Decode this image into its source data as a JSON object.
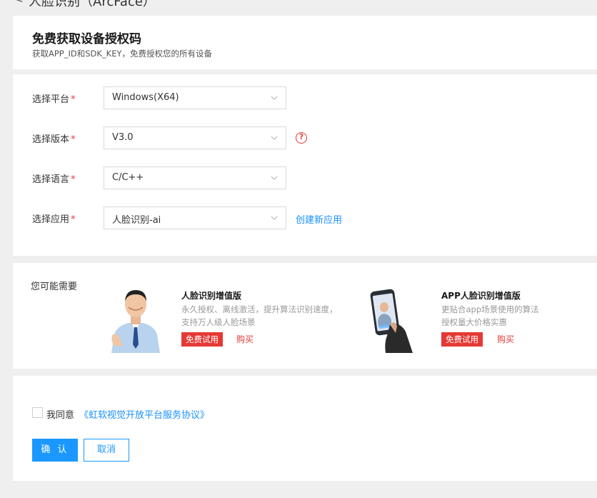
{
  "page": {
    "back_glyph": "<",
    "title": "人脸识别（ArcFace）"
  },
  "header": {
    "title": "免费获取设备授权码",
    "subtitle": "获取APP_ID和SDK_KEY，免费授权您的所有设备"
  },
  "form": {
    "required_mark": "*",
    "rows": [
      {
        "label": "选择平台",
        "value": "Windows(X64)"
      },
      {
        "label": "选择版本",
        "value": "V3.0"
      },
      {
        "label": "选择语言",
        "value": "C/C++"
      },
      {
        "label": "选择应用",
        "value": "人脸识别-ai"
      }
    ],
    "help_glyph": "?",
    "create_app_link": "创建新应用"
  },
  "recommend": {
    "label": "您可能需要",
    "items": [
      {
        "title": "人脸识别增值版",
        "desc_lines": [
          "永久授权、离线激活，提升算法识别速度，",
          "支持万人级人脸场景"
        ],
        "trial": "免费试用",
        "buy": "购买"
      },
      {
        "title": "APP人脸识别增值版",
        "desc_lines": [
          "更贴合app场景使用的算法",
          "授权量大价格实惠"
        ],
        "trial": "免费试用",
        "buy": "购买"
      }
    ]
  },
  "footer": {
    "agree_text": "我同意",
    "agreement_link": "《虹软视觉开放平台服务协议》",
    "confirm": "确 认",
    "cancel": "取消"
  },
  "colors": {
    "accent": "#1a98ff",
    "danger": "#e53935",
    "background": "#efefef"
  }
}
